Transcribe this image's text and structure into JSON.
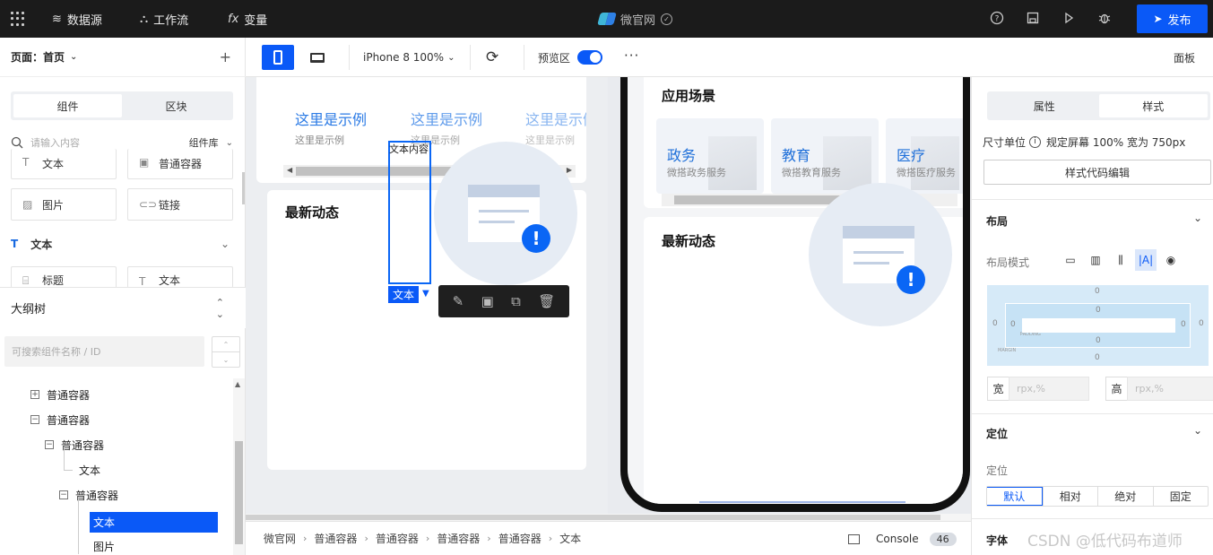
{
  "topbar": {
    "nav": [
      {
        "label": "数据源",
        "icon": "database-icon"
      },
      {
        "label": "工作流",
        "icon": "workflow-icon"
      },
      {
        "label": "变量",
        "icon": "fx-icon"
      }
    ],
    "app_name": "微官网",
    "publish_label": "发布",
    "icons": [
      "help-icon",
      "save-icon",
      "play-icon",
      "debug-icon"
    ]
  },
  "left": {
    "page_label": "页面：首页",
    "tabs": [
      "组件",
      "区块"
    ],
    "active_tab": "组件",
    "search_placeholder": "请输入内容",
    "library_label": "组件库",
    "components_top": [
      {
        "label": "文本",
        "icon": "text-icon"
      },
      {
        "label": "普通容器",
        "icon": "container-icon"
      },
      {
        "label": "图片",
        "icon": "image-icon"
      },
      {
        "label": "链接",
        "icon": "link-icon"
      }
    ],
    "text_section": {
      "title": "文本",
      "items": [
        {
          "label": "标题",
          "icon": "heading-icon"
        },
        {
          "label": "文本",
          "icon": "text-icon"
        }
      ]
    },
    "outline": {
      "title": "大纲树",
      "search_placeholder": "可搜索组件名称 / ID",
      "items": [
        "普通容器",
        "普通容器",
        "普通容器",
        "文本",
        "普通容器",
        "文本",
        "图片"
      ],
      "selected_index": 5
    }
  },
  "toolbar": {
    "device": "iPhone 8 100%",
    "preview_label": "预览区",
    "preview_on": true,
    "more_label": "···",
    "panel_label": "面板"
  },
  "canvas": {
    "examples": [
      {
        "title": "这里是示例",
        "sub": "这里是示例"
      },
      {
        "title": "这里是示例",
        "sub": "这里是示例"
      },
      {
        "title": "这里是示例",
        "sub": "这里是示例"
      }
    ],
    "news_title": "最新动态",
    "selected_text": "文本内容",
    "selected_tag": "文本",
    "phone": {
      "scene_title": "应用场景",
      "scenes": [
        {
          "title": "政务",
          "sub": "微搭政务服务"
        },
        {
          "title": "教育",
          "sub": "微搭教育服务"
        },
        {
          "title": "医疗",
          "sub": "微搭医疗服务"
        }
      ],
      "news_title": "最新动态"
    }
  },
  "breadcrumb": [
    "微官网",
    "普通容器",
    "普通容器",
    "普通容器",
    "普通容器",
    "文本"
  ],
  "console": {
    "label": "Console",
    "count": "46"
  },
  "right": {
    "tabs": [
      "属性",
      "样式"
    ],
    "active_tab": "样式",
    "unit_label": "尺寸单位",
    "unit_value": "规定屏幕 100% 宽为 750px",
    "code_btn": "样式代码编辑",
    "layout_title": "布局",
    "layout_mode_label": "布局模式",
    "box_values": {
      "margin": "0",
      "padding": "0"
    },
    "box_tags": {
      "padding": "PADDING",
      "margin": "MARGIN"
    },
    "width_label": "宽",
    "height_label": "高",
    "size_placeholder": "rpx,%",
    "position_title": "定位",
    "position_label": "定位",
    "position_options": [
      "默认",
      "相对",
      "绝对",
      "固定"
    ],
    "position_active": "默认",
    "font_title": "字体"
  },
  "watermark": "CSDN @低代码布道师",
  "colors": {
    "accent": "#0a59f7",
    "topbar": "#1b1b1b"
  }
}
